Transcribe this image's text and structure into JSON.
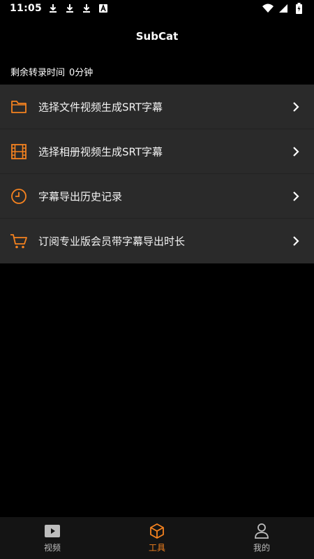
{
  "status_bar": {
    "time": "11:05",
    "left_icons": [
      "download-icon",
      "download-icon",
      "download-icon",
      "android-a-icon"
    ],
    "right_icons": [
      "wifi-icon",
      "signal-icon",
      "battery-icon"
    ]
  },
  "header": {
    "title": "SubCat"
  },
  "remaining": {
    "label": "剩余转录时间",
    "value": "0分钟"
  },
  "menu": {
    "items": [
      {
        "label": "选择文件视频生成SRT字幕",
        "icon": "folder-icon"
      },
      {
        "label": "选择相册视频生成SRT字幕",
        "icon": "film-icon"
      },
      {
        "label": "字幕导出历史记录",
        "icon": "clock-icon"
      },
      {
        "label": "订阅专业版会员带字幕导出时长",
        "icon": "cart-icon"
      }
    ]
  },
  "bottom_nav": {
    "items": [
      {
        "label": "视频",
        "icon": "play-icon",
        "active": false
      },
      {
        "label": "工具",
        "icon": "box-icon",
        "active": true
      },
      {
        "label": "我的",
        "icon": "user-icon",
        "active": false
      }
    ]
  },
  "colors": {
    "background": "#000000",
    "menu_bg": "#2a2a2a",
    "accent": "#f5821f",
    "nav_bg": "#141414",
    "nav_inactive": "#bdbdbd"
  }
}
